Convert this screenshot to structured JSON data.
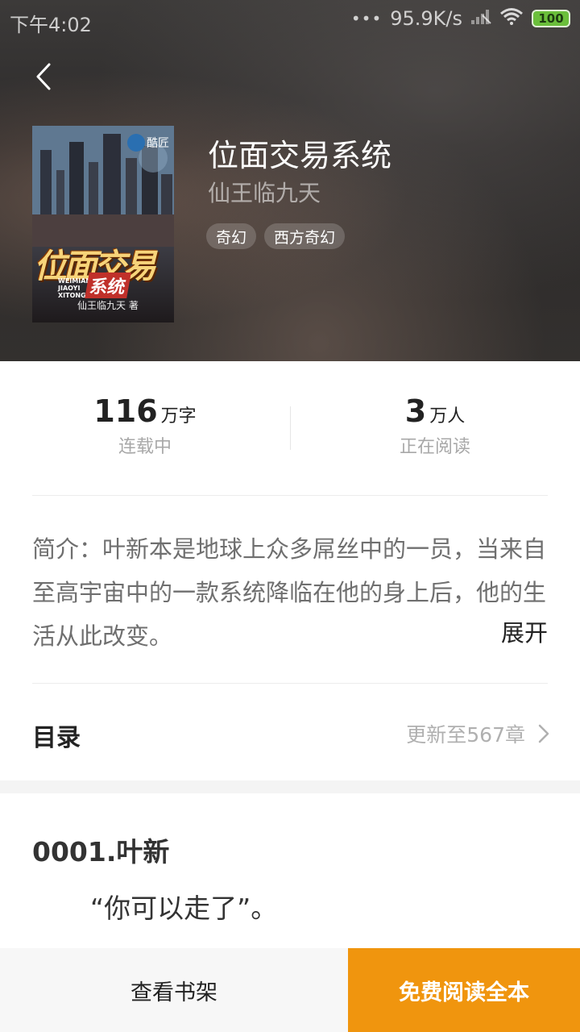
{
  "status_bar": {
    "time": "下午4:02",
    "network_speed": "95.9K/s",
    "battery": "100"
  },
  "book": {
    "title": "位面交易系统",
    "author": "仙王临九天",
    "tags": [
      "奇幻",
      "西方奇幻"
    ],
    "cover": {
      "title_text": "位面交易",
      "subtitle_text": "系统",
      "pinyin_text": "WEIMIAN JIAOYI XITONG",
      "author_text": "仙王临九天 著",
      "badge_text": "酷匠"
    }
  },
  "stats": {
    "word_count": "116",
    "word_unit": "万字",
    "status": "连载中",
    "readers": "3",
    "readers_unit": "万人",
    "readers_label": "正在阅读"
  },
  "intro": {
    "text": "简介：叶新本是地球上众多屌丝中的一员，当来自至高宇宙中的一款系统降临在他的身上后，他的生活从此改变。",
    "expand_label": "展开"
  },
  "toc": {
    "label": "目录",
    "update_text": "更新至567章"
  },
  "chapter": {
    "title": "0001.叶新",
    "first_line": "“你可以走了”。"
  },
  "bottom_bar": {
    "shelf_label": "查看书架",
    "read_label": "免费阅读全本"
  },
  "colors": {
    "accent": "#f0950e",
    "battery": "#6bbf3b"
  }
}
